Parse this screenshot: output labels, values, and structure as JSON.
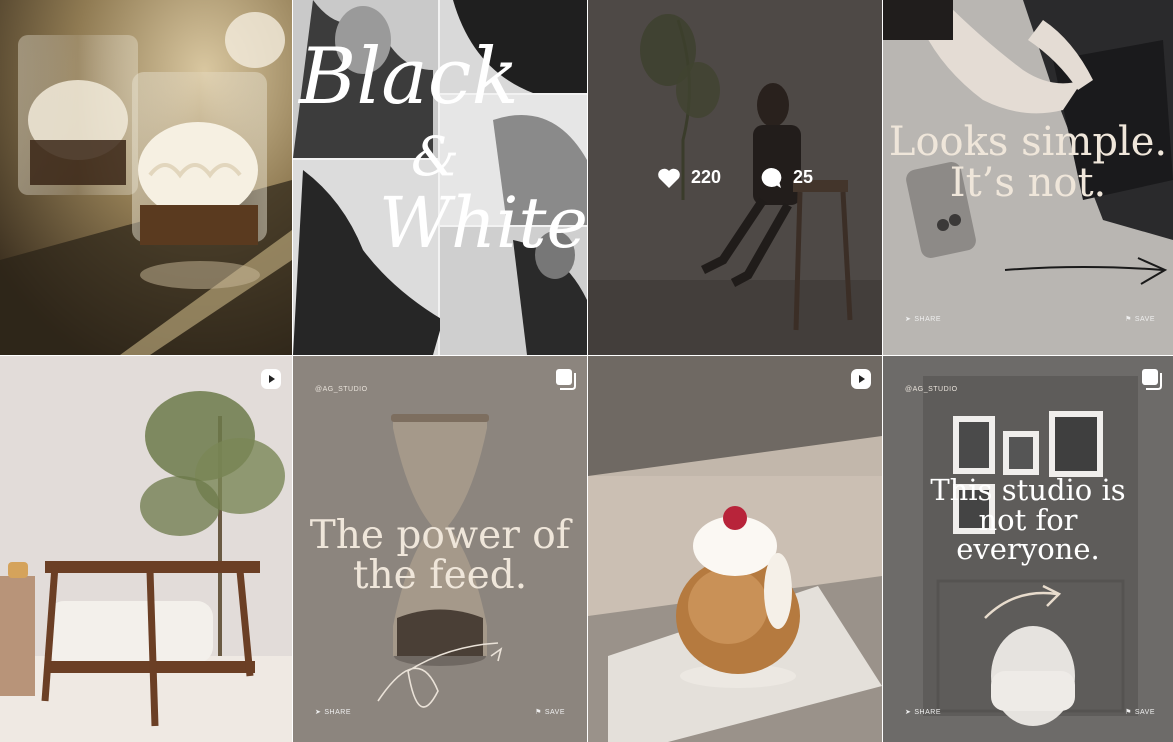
{
  "grid": {
    "posts": [
      {
        "type": "image",
        "subject": "cream dessert cups"
      },
      {
        "type": "image",
        "overlay_title_line1": "Black",
        "overlay_title_line2": "&",
        "overlay_title_line3": "White"
      },
      {
        "type": "image",
        "likes": "220",
        "comments": "25"
      },
      {
        "type": "carousel",
        "headline_line1": "Looks simple.",
        "headline_line2": "It’s not.",
        "share_label": "SHARE",
        "save_label": "SAVE"
      },
      {
        "type": "reel"
      },
      {
        "type": "carousel",
        "handle": "@AG_STUDIO",
        "headline_line1": "The power of",
        "headline_line2": "the feed.",
        "share_label": "SHARE",
        "save_label": "SAVE"
      },
      {
        "type": "reel"
      },
      {
        "type": "carousel",
        "handle": "@AG_STUDIO",
        "headline_line1": "This studio is",
        "headline_line2": "not for",
        "headline_line3": "everyone.",
        "share_label": "SHARE",
        "save_label": "SAVE"
      }
    ]
  },
  "colors": {
    "cream_text": "#efe6da",
    "overlay": "#28221e"
  }
}
